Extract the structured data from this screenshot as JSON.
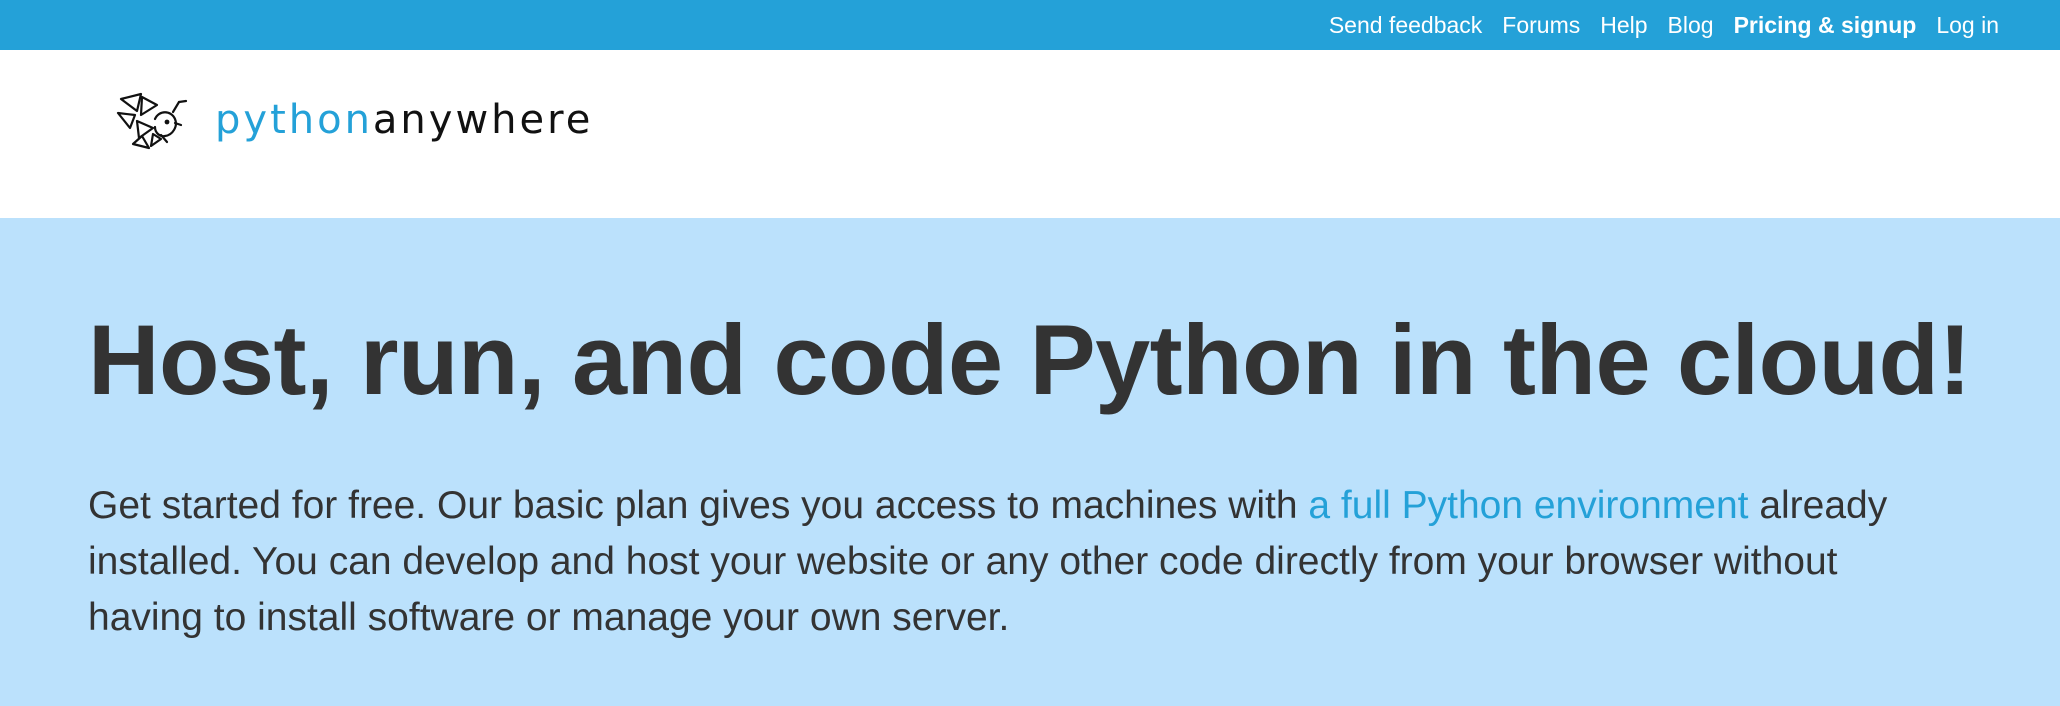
{
  "top_nav": {
    "items": [
      {
        "label": "Send feedback",
        "bold": false
      },
      {
        "label": "Forums",
        "bold": false
      },
      {
        "label": "Help",
        "bold": false
      },
      {
        "label": "Blog",
        "bold": false
      },
      {
        "label": "Pricing & signup",
        "bold": true
      },
      {
        "label": "Log in",
        "bold": false
      }
    ]
  },
  "logo": {
    "icon": "pythonanywhere-snake-logo-icon",
    "part1": "python",
    "part2": "anywhere"
  },
  "hero": {
    "headline": "Host, run, and code Python in the cloud!",
    "intro_before_link": "Get started for free. Our basic plan gives you access to machines with ",
    "intro_link": "a full Python environment",
    "intro_after_link": " already installed. You can develop and host your website or any other code directly from your browser without having to install software or manage your own server."
  },
  "colors": {
    "brand_blue": "#24a1d8",
    "hero_background": "#bbe1fc",
    "text_dark": "#333333"
  }
}
